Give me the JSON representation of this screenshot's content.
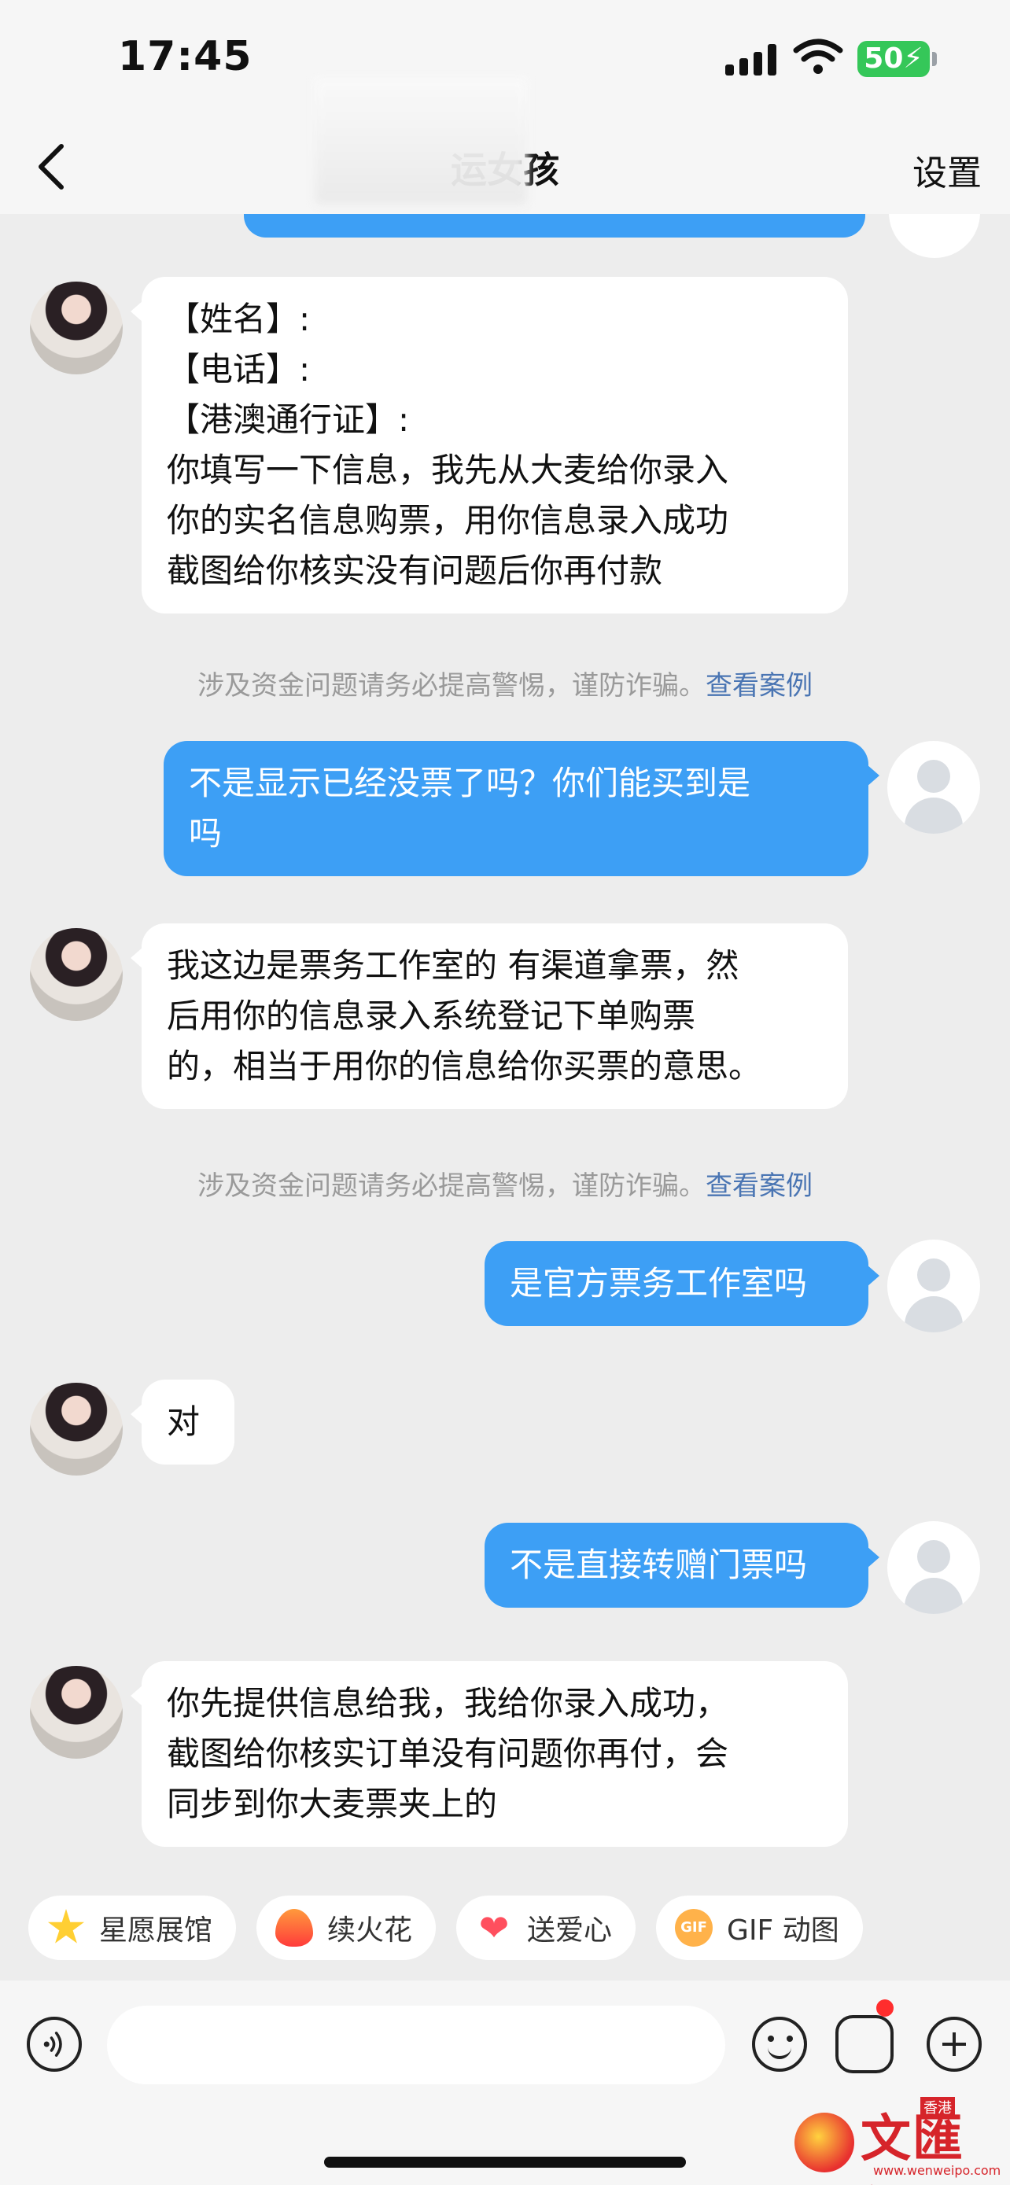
{
  "status_bar": {
    "time": "17:45",
    "battery": "50"
  },
  "header": {
    "title": "运女孩",
    "settings_label": "设置"
  },
  "messages": [
    {
      "from": "other",
      "lines": [
        "【姓名】:",
        "【电话】:",
        "【港澳通行证】:",
        "你填写一下信息，我先从大麦给你录入",
        "你的实名信息购票，用你信息录入成功",
        "截图给你核实没有问题后你再付款"
      ]
    },
    {
      "from": "me",
      "lines": [
        "不是显示已经没票了吗？你们能买到是",
        "吗"
      ]
    },
    {
      "from": "other",
      "lines": [
        "我这边是票务工作室的 有渠道拿票，然",
        "后用你的信息录入系统登记下单购票",
        "的，相当于用你的信息给你买票的意思。"
      ]
    },
    {
      "from": "me",
      "lines": [
        "是官方票务工作室吗"
      ]
    },
    {
      "from": "other",
      "lines": [
        "对"
      ]
    },
    {
      "from": "me",
      "lines": [
        "不是直接转赠门票吗"
      ]
    },
    {
      "from": "other",
      "lines": [
        "你先提供信息给我，我给你录入成功，",
        "截图给你核实订单没有问题你再付，会",
        "同步到你大麦票夹上的"
      ]
    }
  ],
  "warning": {
    "text": "涉及资金问题请务必提高警惕，谨防诈骗。",
    "link": "查看案例"
  },
  "quick_actions": [
    {
      "icon": "star-icon",
      "label": "星愿展馆"
    },
    {
      "icon": "fire-icon",
      "label": "续火花"
    },
    {
      "icon": "heart-icon",
      "label": "送爱心"
    },
    {
      "icon": "gif-icon",
      "label": "GIF 动图"
    }
  ],
  "watermark": {
    "title": "文匯網",
    "tag": "香港",
    "url": "www.wenweipo.com"
  },
  "colors": {
    "outgoing_bubble": "#3d9ff5",
    "incoming_bubble": "#ffffff",
    "background": "#ededed",
    "link": "#4a75b3"
  }
}
